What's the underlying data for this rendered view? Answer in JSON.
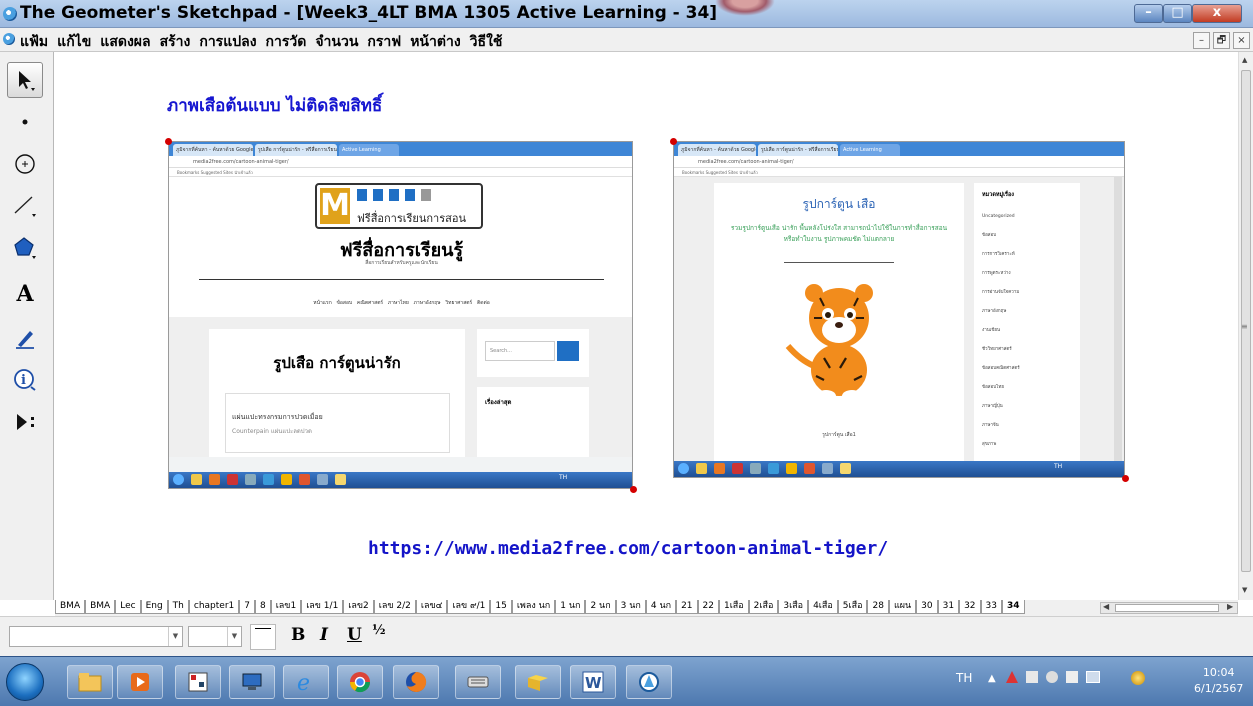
{
  "window": {
    "title": "The Geometer's Sketchpad - [Week3_4LT BMA 1305 Active Learning - 34]",
    "minimize": "–",
    "maximize": "□",
    "close": "x"
  },
  "menu": {
    "items": [
      "แฟ้ม",
      "แก้ไข",
      "แสดงผล",
      "สร้าง",
      "การแปลง",
      "การวัด",
      "จำนวน",
      "กราฟ",
      "หน้าต่าง",
      "วิธีใช้"
    ],
    "mdi_min": "–",
    "mdi_restore": "🗗",
    "mdi_close": "×"
  },
  "toolbox": {
    "tools": [
      "arrow-select-icon",
      "point-icon",
      "compass-icon",
      "straightedge-icon",
      "polygon-icon",
      "text-tool-icon",
      "marker-icon",
      "information-icon",
      "custom-tool-icon"
    ],
    "text_tool_label": "A"
  },
  "canvas": {
    "heading": "ภาพเสือต้นแบบ   ไม่ติดลิขสิทธิ์",
    "url": "https://www.media2free.com/cartoon-animal-tiger/",
    "left_screenshot": {
      "tab1": "ภูมิจากที่ค้นหา - ค้นหาด้วย Google",
      "tab2": "รูปเสือ การ์ตูนน่ารัก - ฟรีสื่อการเรียน",
      "tab3": "Active Learning",
      "address": "media2free.com/cartoon-animal-tiger/",
      "bookmarks": "Bookmarks   Suggested Sites   นำเข้าแล้ว",
      "logo_text": "ฟรีสื่อการเรียนการสอน",
      "site_title": "ฟรีสื่อการเรียนรู้",
      "site_subtitle": "สื่อการเรียนสำหรับครูและนักเรียน",
      "nav": "หน้าแรก   ข้อสอบ   คณิตศาสตร์   ภาษาไทย   ภาษาอังกฤษ   วิทยาศาสตร์   ติดต่อ",
      "post_title": "รูปเสือ การ์ตูนน่ารัก",
      "search_placeholder": "Search...",
      "sidebar_title": "เรื่องล่าสุด",
      "ad_line1": "แผ่นแปะทรงกรมการปวดเมื่อย",
      "ad_line2": "Counterpain แผ่นแปะลดปวด",
      "tray": "TH"
    },
    "right_screenshot": {
      "tab1": "ภูมิจากที่ค้นหา - ค้นหาด้วย Google",
      "tab2": "รูปเสือ การ์ตูนน่ารัก - ฟรีสื่อการเรียน",
      "tab3": "Active Learning",
      "address": "media2free.com/cartoon-animal-tiger/",
      "bookmarks": "Bookmarks   Suggested Sites   นำเข้าแล้ว",
      "post_title": "รูปการ์ตูน เสือ",
      "intro": "รวมรูปการ์ตูนเสือ น่ารัก พื้นหลังโปร่งใส สามารถนำไปใช้ในการทำสื่อการสอน หรือทำใบงาน รูปภาพคมชัด ไม่แตกลาย",
      "caption": "รูปการ์ตูน เสือ1",
      "sidebar_title": "หมวดหมู่เรื่อง",
      "sidebar_items": [
        "Uncategorized",
        "ข้อสอบ",
        "การการวิเคราะห์",
        "การพูดระหว่าง",
        "การอ่านจับใจความ",
        "ภาษาอังกฤษ",
        "งานเขียน",
        "ชีววิทยาศาสตร์",
        "ข้อสอบคณิตศาสตร์",
        "ข้อสอบไทย",
        "ภาษาญี่ปุ่น",
        "ภาษาจีน",
        "สุขภาพ"
      ],
      "tray": "TH"
    }
  },
  "page_tabs": [
    "BMA",
    "BMA",
    "Lec",
    "Eng",
    "Th",
    "chapter1",
    "7",
    "8",
    "เลข1",
    "เลข 1/1",
    "เลข2",
    "เลข 2/2",
    "เลข๔",
    "เลข ๙/1",
    "15",
    "เพลง นก",
    "1 นก",
    "2 นก",
    "3 นก",
    "4 นก",
    "21",
    "22",
    "1เสือ",
    "2เสือ",
    "3เสือ",
    "4เสือ",
    "5เสือ",
    "28",
    "แผน",
    "30",
    "31",
    "32",
    "33",
    "34"
  ],
  "active_page": "34",
  "text_toolbar": {
    "bold": "B",
    "italic": "I",
    "underline": "U",
    "math_format": "½"
  },
  "taskbar": {
    "apps": [
      "file-explorer-icon",
      "media-player-icon",
      "sketch-grid-icon",
      "remote-desktop-icon",
      "internet-explorer-icon",
      "chrome-icon",
      "firefox-icon",
      "keyboard-icon",
      "folder-icon",
      "word-icon",
      "sketchpad-icon"
    ],
    "language": "TH",
    "time": "10:04",
    "date": "6/1/2567"
  },
  "colors": {
    "heading": "#1515d0",
    "url": "#1414c8",
    "handle": "#d40000",
    "titlebar": "#bcd3ee",
    "taskbar": "#4d78af"
  }
}
